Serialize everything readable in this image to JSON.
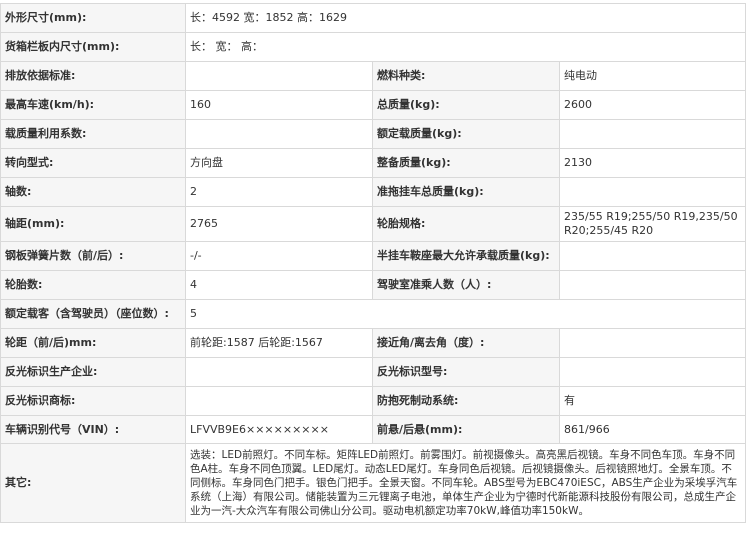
{
  "rows": [
    {
      "l1": "外形尺寸(mm):",
      "v1": "长：4592 宽：1852 高：1629"
    },
    {
      "l1": "货箱栏板内尺寸(mm):",
      "v1": "长： 宽： 高："
    },
    {
      "l1": "排放依据标准:",
      "v1": "",
      "l2": "燃料种类:",
      "v2": "纯电动"
    },
    {
      "l1": "最高车速(km/h):",
      "v1": "160",
      "l2": "总质量(kg):",
      "v2": "2600"
    },
    {
      "l1": "载质量利用系数:",
      "v1": "",
      "l2": "额定载质量(kg):",
      "v2": ""
    },
    {
      "l1": "转向型式:",
      "v1": "方向盘",
      "l2": "整备质量(kg):",
      "v2": "2130"
    },
    {
      "l1": "轴数:",
      "v1": "2",
      "l2": "准拖挂车总质量(kg):",
      "v2": ""
    },
    {
      "l1": "轴距(mm):",
      "v1": "2765",
      "l2": "轮胎规格:",
      "v2": "235/55 R19;255/50 R19,235/50 R20;255/45 R20"
    },
    {
      "l1": "钢板弹簧片数（前/后）:",
      "v1": "-/-",
      "l2": "半挂车鞍座最大允许承载质量(kg):",
      "v2": ""
    },
    {
      "l1": "轮胎数:",
      "v1": "4",
      "l2": "驾驶室准乘人数（人）:",
      "v2": ""
    },
    {
      "l1": "额定载客（含驾驶员）（座位数）:",
      "v1": "5"
    },
    {
      "l1": "轮距（前/后)mm:",
      "v1": "前轮距:1587 后轮距:1567",
      "l2": "接近角/离去角（度）:",
      "v2": ""
    },
    {
      "l1": "反光标识生产企业:",
      "v1": "",
      "l2": "反光标识型号:",
      "v2": ""
    },
    {
      "l1": "反光标识商标:",
      "v1": "",
      "l2": "防抱死制动系统:",
      "v2": "有"
    },
    {
      "l1": "车辆识别代号（VIN）:",
      "v1": "LFVVB9E6×××××××××",
      "l2": "前悬/后悬(mm):",
      "v2": "861/966"
    },
    {
      "l1": "其它:",
      "v1": "选装：LED前照灯。不同车标。矩阵LED前照灯。前雾围灯。前视摄像头。高亮黑后视镜。车身不同色车顶。车身不同色A柱。车身不同色顶翼。LED尾灯。动态LED尾灯。车身同色后视镜。后视镜摄像头。后视镜照地灯。全景车顶。不同侧标。车身同色门把手。银色门把手。全景天窗。不同车轮。ABS型号为EBC470iESC，ABS生产企业为采埃孚汽车系统（上海）有限公司。储能装置为三元锂离子电池，单体生产企业为宁德时代新能源科技股份有限公司，总成生产企业为一汽-大众汽车有限公司佛山分公司。驱动电机额定功率70kW,峰值功率150kW。"
    }
  ]
}
